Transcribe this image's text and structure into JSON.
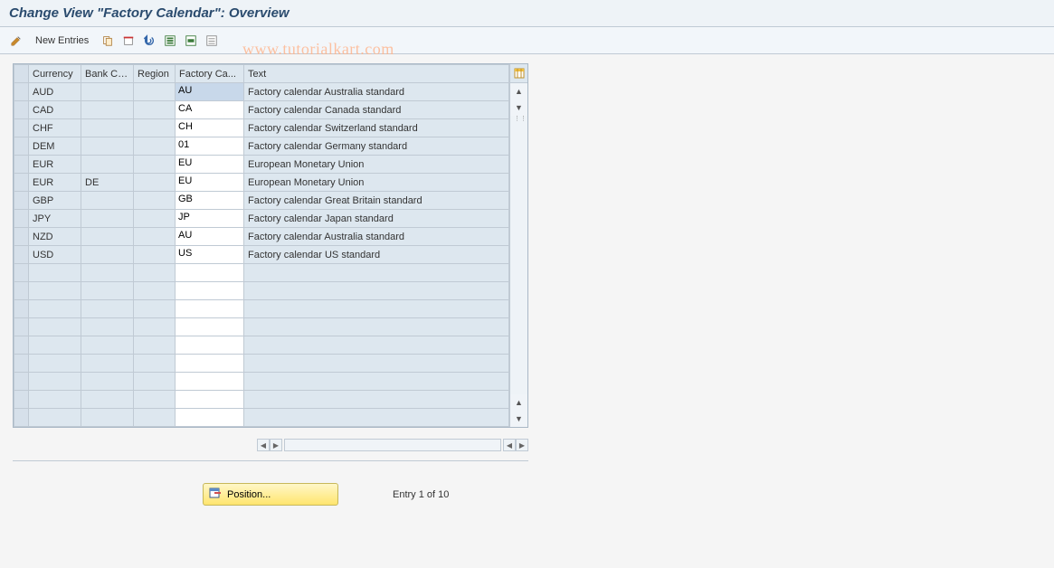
{
  "header": {
    "title": "Change View \"Factory Calendar\": Overview"
  },
  "toolbar": {
    "new_entries_label": "New Entries"
  },
  "watermark": "www.tutorialkart.com",
  "columns": {
    "currency": "Currency",
    "bank_country": "Bank Co...",
    "region": "Region",
    "factory_cal": "Factory Ca...",
    "text": "Text"
  },
  "rows": [
    {
      "currency": "AUD",
      "bank": "",
      "region": "",
      "factory": "AU",
      "text": "Factory calendar Australia standard",
      "selected": true
    },
    {
      "currency": "CAD",
      "bank": "",
      "region": "",
      "factory": "CA",
      "text": "Factory calendar Canada standard"
    },
    {
      "currency": "CHF",
      "bank": "",
      "region": "",
      "factory": "CH",
      "text": "Factory calendar Switzerland standard"
    },
    {
      "currency": "DEM",
      "bank": "",
      "region": "",
      "factory": "01",
      "text": "Factory calendar Germany standard"
    },
    {
      "currency": "EUR",
      "bank": "",
      "region": "",
      "factory": "EU",
      "text": "European Monetary Union"
    },
    {
      "currency": "EUR",
      "bank": "DE",
      "region": "",
      "factory": "EU",
      "text": "European Monetary Union"
    },
    {
      "currency": "GBP",
      "bank": "",
      "region": "",
      "factory": "GB",
      "text": "Factory calendar Great Britain standard"
    },
    {
      "currency": "JPY",
      "bank": "",
      "region": "",
      "factory": "JP",
      "text": "Factory calendar Japan standard"
    },
    {
      "currency": "NZD",
      "bank": "",
      "region": "",
      "factory": "AU",
      "text": "Factory calendar Australia standard"
    },
    {
      "currency": "USD",
      "bank": "",
      "region": "",
      "factory": "US",
      "text": "Factory calendar US standard"
    }
  ],
  "empty_row_count": 9,
  "footer": {
    "position_label": "Position...",
    "entry_text": "Entry 1 of 10"
  }
}
